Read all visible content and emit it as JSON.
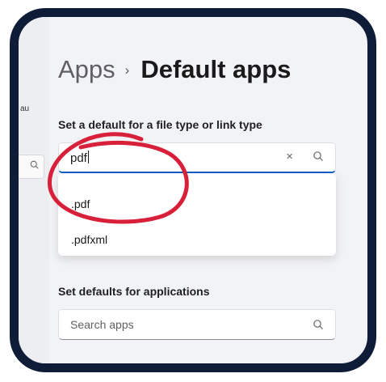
{
  "sidebar": {
    "partial_text": "au"
  },
  "breadcrumb": {
    "parent": "Apps",
    "separator": "›",
    "current": "Default apps"
  },
  "file_type_section": {
    "heading": "Set a default for a file type or link type",
    "search_value": "pdf",
    "clear_icon": "×",
    "suggestions": [
      ".pdf",
      ".pdfxml"
    ]
  },
  "apps_section": {
    "heading": "Set defaults for applications",
    "search_placeholder": "Search apps"
  },
  "colors": {
    "frame_border": "#0e1c38",
    "accent": "#0a5fc8",
    "annotation": "#d9203a"
  },
  "icons": [
    "search-icon",
    "clear-icon"
  ]
}
